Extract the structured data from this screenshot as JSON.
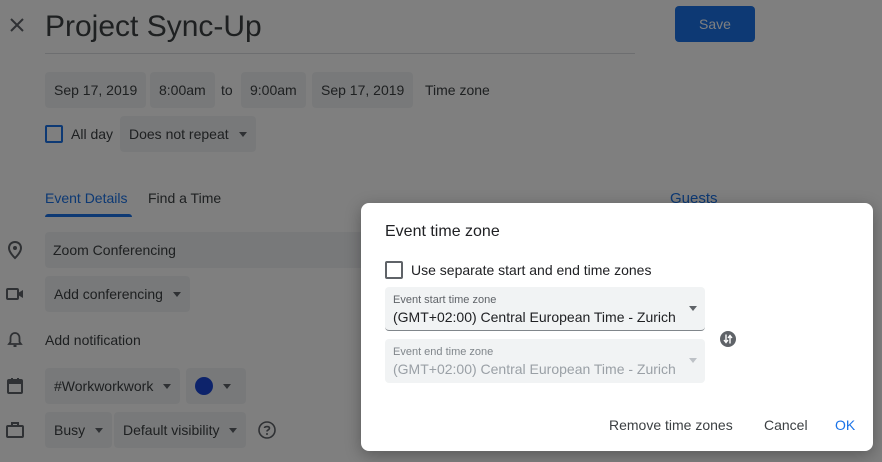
{
  "header": {
    "title": "Project Sync-Up",
    "save_label": "Save"
  },
  "datetime": {
    "start_date": "Sep 17, 2019",
    "start_time": "8:00am",
    "to_label": "to",
    "end_time": "9:00am",
    "end_date": "Sep 17, 2019",
    "timezone_label": "Time zone",
    "all_day_label": "All day",
    "repeat_value": "Does not repeat"
  },
  "tabs": [
    {
      "label": "Event Details",
      "active": true
    },
    {
      "label": "Find a Time",
      "active": false
    }
  ],
  "guests_label": "Guests",
  "details": {
    "location": "Zoom Conferencing",
    "conferencing": "Add conferencing",
    "notification": "Add notification",
    "calendar": "#Workworkwork",
    "calendar_color": "#1a47d6",
    "availability": "Busy",
    "visibility": "Default visibility"
  },
  "dialog": {
    "title": "Event time zone",
    "separate_label": "Use separate start and end time zones",
    "start_tz_label": "Event start time zone",
    "start_tz_value": "(GMT+02:00) Central European Time - Zurich",
    "end_tz_label": "Event end time zone",
    "end_tz_value": "(GMT+02:00) Central European Time - Zurich",
    "remove_label": "Remove time zones",
    "cancel_label": "Cancel",
    "ok_label": "OK"
  },
  "colors": {
    "accent": "#1a73e8",
    "overlay": "rgba(0,0,0,0.5)"
  }
}
